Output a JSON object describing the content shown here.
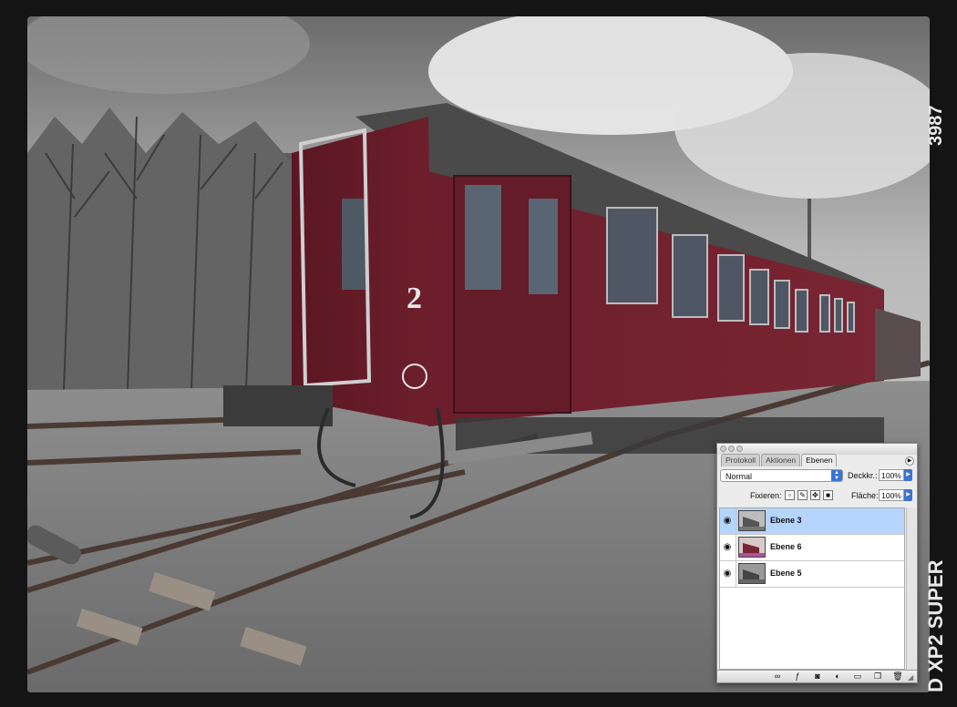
{
  "film_edge": {
    "frame_number": "3987",
    "brand": "D XP2 SUPER"
  },
  "palette": {
    "tabs": [
      {
        "label": "Protokoll",
        "active": false
      },
      {
        "label": "Aktionen",
        "active": false
      },
      {
        "label": "Ebenen",
        "active": true
      }
    ],
    "blend_mode": "Normal",
    "opacity_label": "Deckkr.:",
    "opacity_value": "100%",
    "lock_label": "Fixieren:",
    "fill_label": "Fläche:",
    "fill_value": "100%",
    "layers": [
      {
        "name": "Ebene 3",
        "visible": true,
        "selected": true,
        "thumb": "grayscale-photo"
      },
      {
        "name": "Ebene 6",
        "visible": true,
        "selected": false,
        "thumb": "red-train-color"
      },
      {
        "name": "Ebene 5",
        "visible": true,
        "selected": false,
        "thumb": "grayscale-photo"
      }
    ],
    "bottom_icons": [
      "link-icon",
      "layer-style-icon",
      "mask-icon",
      "adjustment-icon",
      "folder-icon",
      "new-layer-icon",
      "trash-icon"
    ]
  },
  "colors": {
    "train_red": "#6e1f2c",
    "selection_blue": "#b5d5ff",
    "accent_blue": "#3b73d3"
  }
}
